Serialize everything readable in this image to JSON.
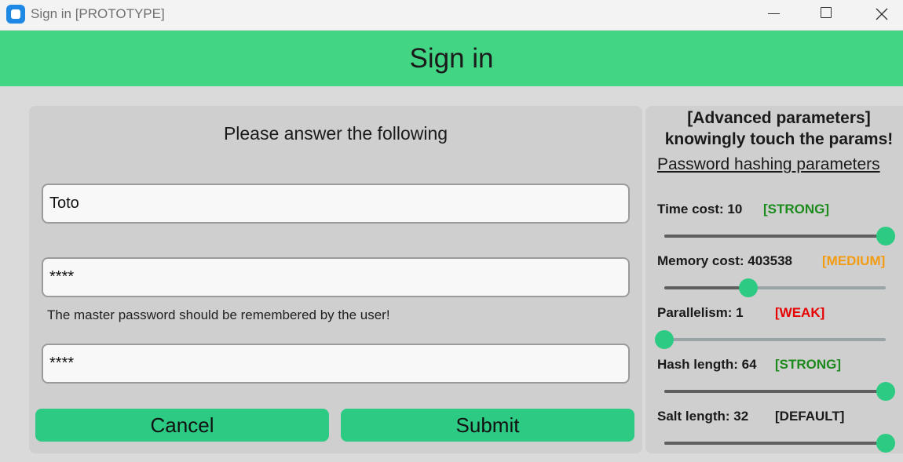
{
  "window": {
    "title": "Sign in [PROTOTYPE]"
  },
  "header": {
    "title": "Sign in"
  },
  "form": {
    "prompt": "Please answer the following",
    "username_value": "Toto",
    "password_value": "****",
    "password_hint": "The master password should be remembered by the user!",
    "confirm_value": "****",
    "cancel_label": "Cancel",
    "submit_label": "Submit"
  },
  "advanced": {
    "title_line1": "[Advanced parameters]",
    "title_line2": "knowingly touch the params!",
    "subtitle": "Password hashing parameters",
    "params": [
      {
        "label": "Time cost: 10",
        "level": "[STRONG]",
        "slider_fraction": 1.0
      },
      {
        "label": "Memory cost: 403538",
        "level": "[MEDIUM]",
        "slider_fraction": 0.38
      },
      {
        "label": "Parallelism: 1",
        "level": "[WEAK]",
        "slider_fraction": 0.0
      },
      {
        "label": "Hash length: 64",
        "level": "[STRONG]",
        "slider_fraction": 1.0
      },
      {
        "label": "Salt length: 32",
        "level": "[DEFAULT]",
        "slider_fraction": 1.0
      }
    ]
  },
  "colors": {
    "header_bg": "#42d584",
    "button_bg": "#2dca84",
    "strong": "#1c8a1c",
    "medium": "#f39c12",
    "weak": "#e60000",
    "default": "#1a1a1a"
  }
}
